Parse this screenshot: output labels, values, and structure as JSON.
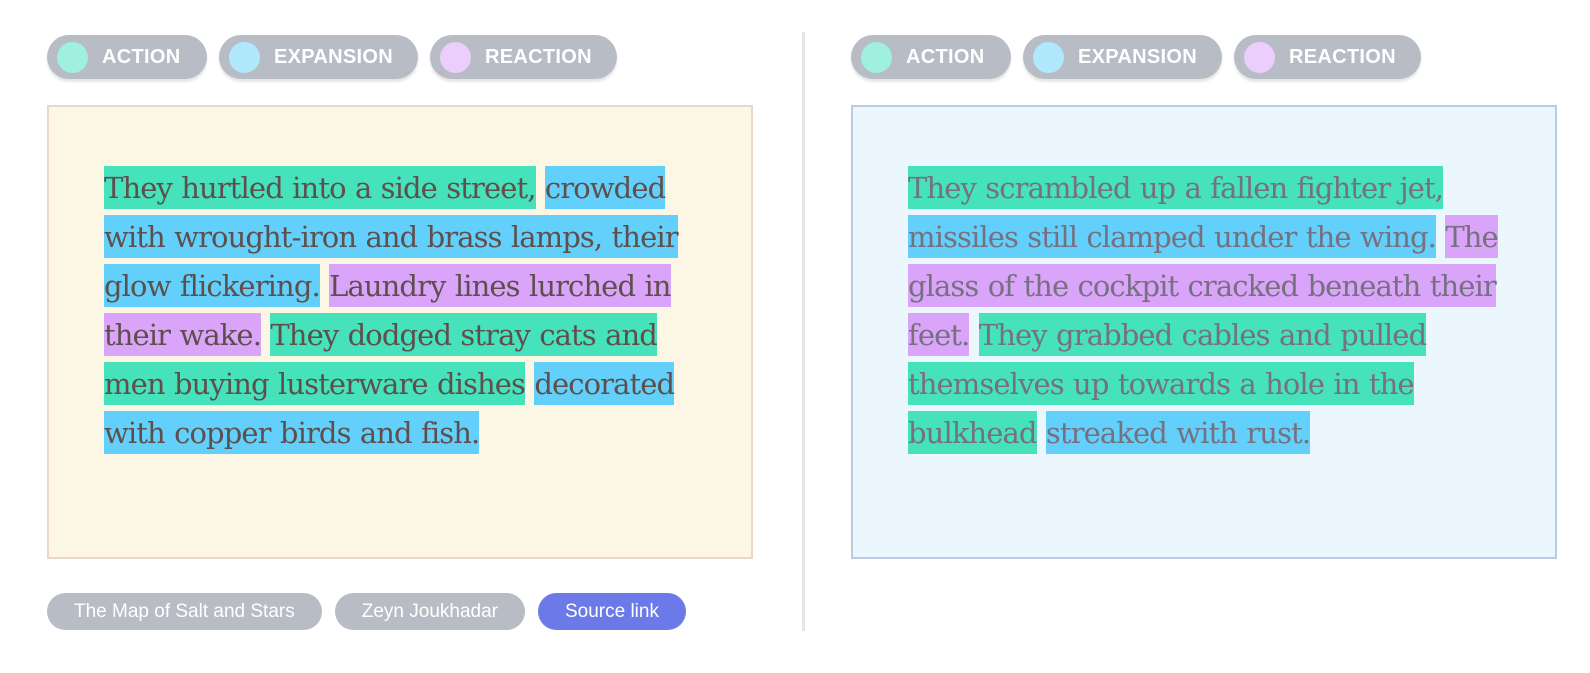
{
  "legend": {
    "items": [
      {
        "key": "action",
        "label": "ACTION",
        "dot_color": "#9ff0de"
      },
      {
        "key": "expansion",
        "label": "EXPANSION",
        "dot_color": "#b0e8fd"
      },
      {
        "key": "reaction",
        "label": "REACTION",
        "dot_color": "#ebcefc"
      }
    ]
  },
  "colors": {
    "action": "#45e2bb",
    "expansion": "#62d0fb",
    "reaction": "#d9a4f9",
    "source_link": "#6b7ae8",
    "tag_gray": "#b8bcc4"
  },
  "left_panel": {
    "segments": [
      {
        "type": "action",
        "text": "They hurtled into a side street,"
      },
      {
        "type": "expansion",
        "text": "crowded with wrought-iron and brass lamps, their glow flickering."
      },
      {
        "type": "reaction",
        "text": "Laundry lines lurched in their wake."
      },
      {
        "type": "action",
        "text": "They dodged stray cats and men buying lusterware dishes"
      },
      {
        "type": "expansion",
        "text": "decorated with copper birds and fish."
      }
    ],
    "book_title": "The Map of Salt and Stars",
    "author": "Zeyn Joukhadar",
    "source_label": "Source link"
  },
  "right_panel": {
    "segments": [
      {
        "type": "action",
        "text": "They scrambled up a fallen fighter jet,"
      },
      {
        "type": "expansion",
        "text": "missiles still clamped under the wing."
      },
      {
        "type": "reaction",
        "text": "The glass of the cockpit cracked beneath their feet."
      },
      {
        "type": "action",
        "text": "They grabbed cables and pulled themselves up towards a hole in the bulkhead"
      },
      {
        "type": "expansion",
        "text": "streaked with rust."
      }
    ]
  }
}
